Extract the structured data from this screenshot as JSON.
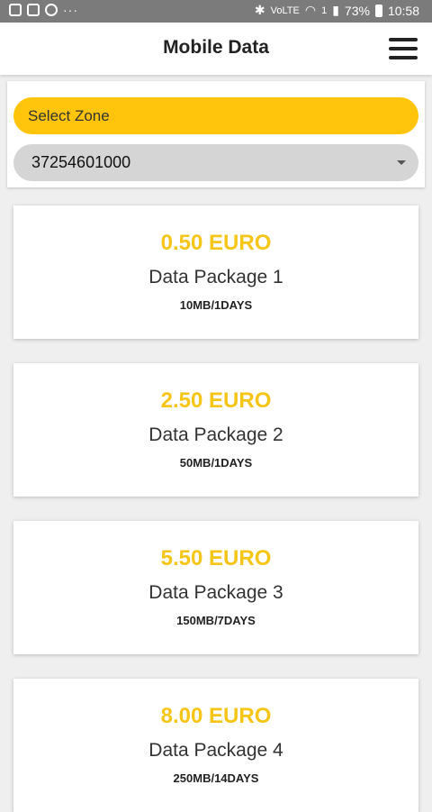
{
  "status_bar": {
    "left_icons": [
      "image-icon",
      "instagram-icon",
      "whatsapp-icon"
    ],
    "more": "···",
    "network": "VoLTE",
    "sim": "1",
    "battery": "73%",
    "time": "10:58"
  },
  "header": {
    "title": "Mobile Data"
  },
  "zone": {
    "select_label": "Select Zone",
    "number_value": "37254601000"
  },
  "packages": [
    {
      "price": "0.50 EURO",
      "name": "Data Package 1",
      "detail": "10MB/1DAYS"
    },
    {
      "price": "2.50 EURO",
      "name": "Data Package 2",
      "detail": "50MB/1DAYS"
    },
    {
      "price": "5.50 EURO",
      "name": "Data Package 3",
      "detail": "150MB/7DAYS"
    },
    {
      "price": "8.00 EURO",
      "name": "Data Package 4",
      "detail": "250MB/14DAYS"
    }
  ],
  "colors": {
    "accent": "#ffc40b",
    "price": "#f5c518",
    "select_bg": "#d5d5d5"
  }
}
